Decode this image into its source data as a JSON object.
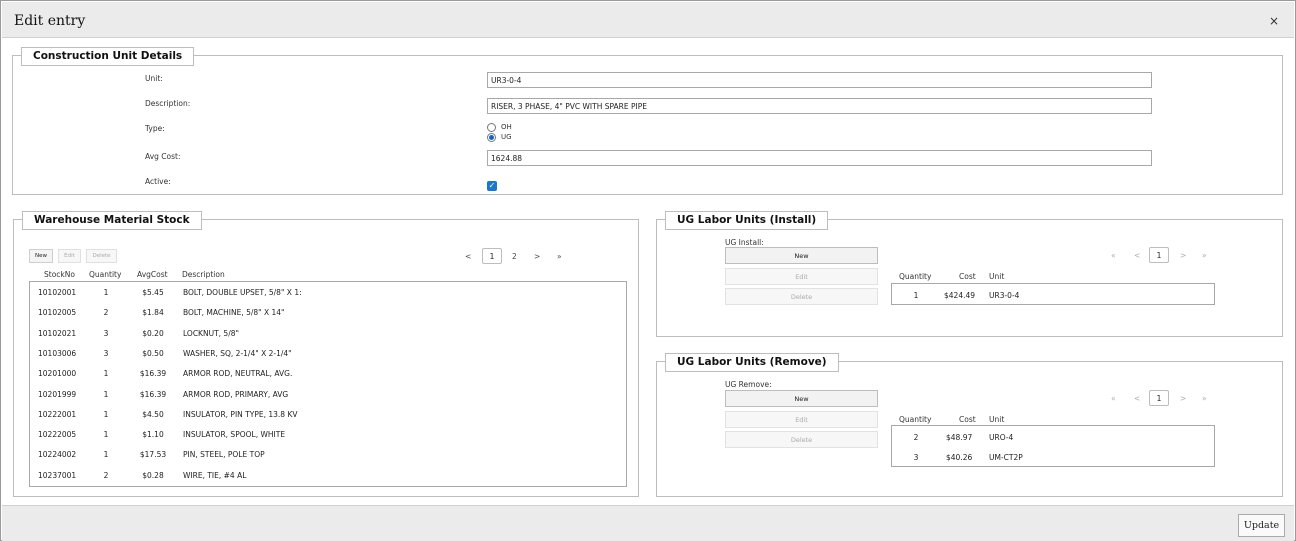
{
  "dialog": {
    "title": "Edit entry",
    "close_glyph": "×",
    "update_label": "Update"
  },
  "details": {
    "legend": "Construction Unit Details",
    "unit_label": "Unit:",
    "unit_value": "UR3-0-4",
    "description_label": "Description:",
    "description_value": "RISER, 3 PHASE, 4\" PVC WITH SPARE PIPE",
    "type_label": "Type:",
    "type_options": [
      "OH",
      "UG"
    ],
    "type_selected": "UG",
    "avgcost_label": "Avg Cost:",
    "avgcost_value": "1624.88",
    "active_label": "Active:",
    "active_checked": true
  },
  "warehouse": {
    "legend": "Warehouse Material Stock",
    "buttons": {
      "new": "New",
      "edit": "Edit",
      "delete": "Delete"
    },
    "pager": {
      "first": "«",
      "prev": "<",
      "pages": [
        "1",
        "2"
      ],
      "current": "1",
      "next": ">",
      "last": "»"
    },
    "columns": [
      "StockNo",
      "Quantity",
      "AvgCost",
      "Description"
    ],
    "rows": [
      [
        "10102001",
        "1",
        "$5.45",
        "BOLT, DOUBLE UPSET, 5/8\" X 1:"
      ],
      [
        "10102005",
        "2",
        "$1.84",
        "BOLT, MACHINE, 5/8\" X 14\""
      ],
      [
        "10102021",
        "3",
        "$0.20",
        "LOCKNUT, 5/8\""
      ],
      [
        "10103006",
        "3",
        "$0.50",
        "WASHER, SQ, 2-1/4\" X 2-1/4\""
      ],
      [
        "10201000",
        "1",
        "$16.39",
        "ARMOR ROD, NEUTRAL, AVG."
      ],
      [
        "10201999",
        "1",
        "$16.39",
        "ARMOR ROD, PRIMARY, AVG"
      ],
      [
        "10222001",
        "1",
        "$4.50",
        "INSULATOR, PIN TYPE, 13.8 KV"
      ],
      [
        "10222005",
        "1",
        "$1.10",
        "INSULATOR, SPOOL, WHITE"
      ],
      [
        "10224002",
        "1",
        "$17.53",
        "PIN, STEEL, POLE TOP"
      ],
      [
        "10237001",
        "2",
        "$0.28",
        "WIRE, TIE, #4 AL"
      ]
    ]
  },
  "install": {
    "legend": "UG Labor Units (Install)",
    "sublabel": "UG Install:",
    "buttons": {
      "new": "New",
      "edit": "Edit",
      "delete": "Delete"
    },
    "pager": {
      "first": "«",
      "prev": "<",
      "current": "1",
      "next": ">",
      "last": "»"
    },
    "columns": [
      "Quantity",
      "Cost",
      "Unit"
    ],
    "rows": [
      [
        "1",
        "$424.49",
        "UR3-0-4"
      ]
    ]
  },
  "remove": {
    "legend": "UG Labor Units (Remove)",
    "sublabel": "UG Remove:",
    "buttons": {
      "new": "New",
      "edit": "Edit",
      "delete": "Delete"
    },
    "pager": {
      "first": "«",
      "prev": "<",
      "current": "1",
      "next": ">",
      "last": "»"
    },
    "columns": [
      "Quantity",
      "Cost",
      "Unit"
    ],
    "rows": [
      [
        "2",
        "$48.97",
        "URO-4"
      ],
      [
        "3",
        "$40.26",
        "UM-CT2P"
      ]
    ]
  }
}
